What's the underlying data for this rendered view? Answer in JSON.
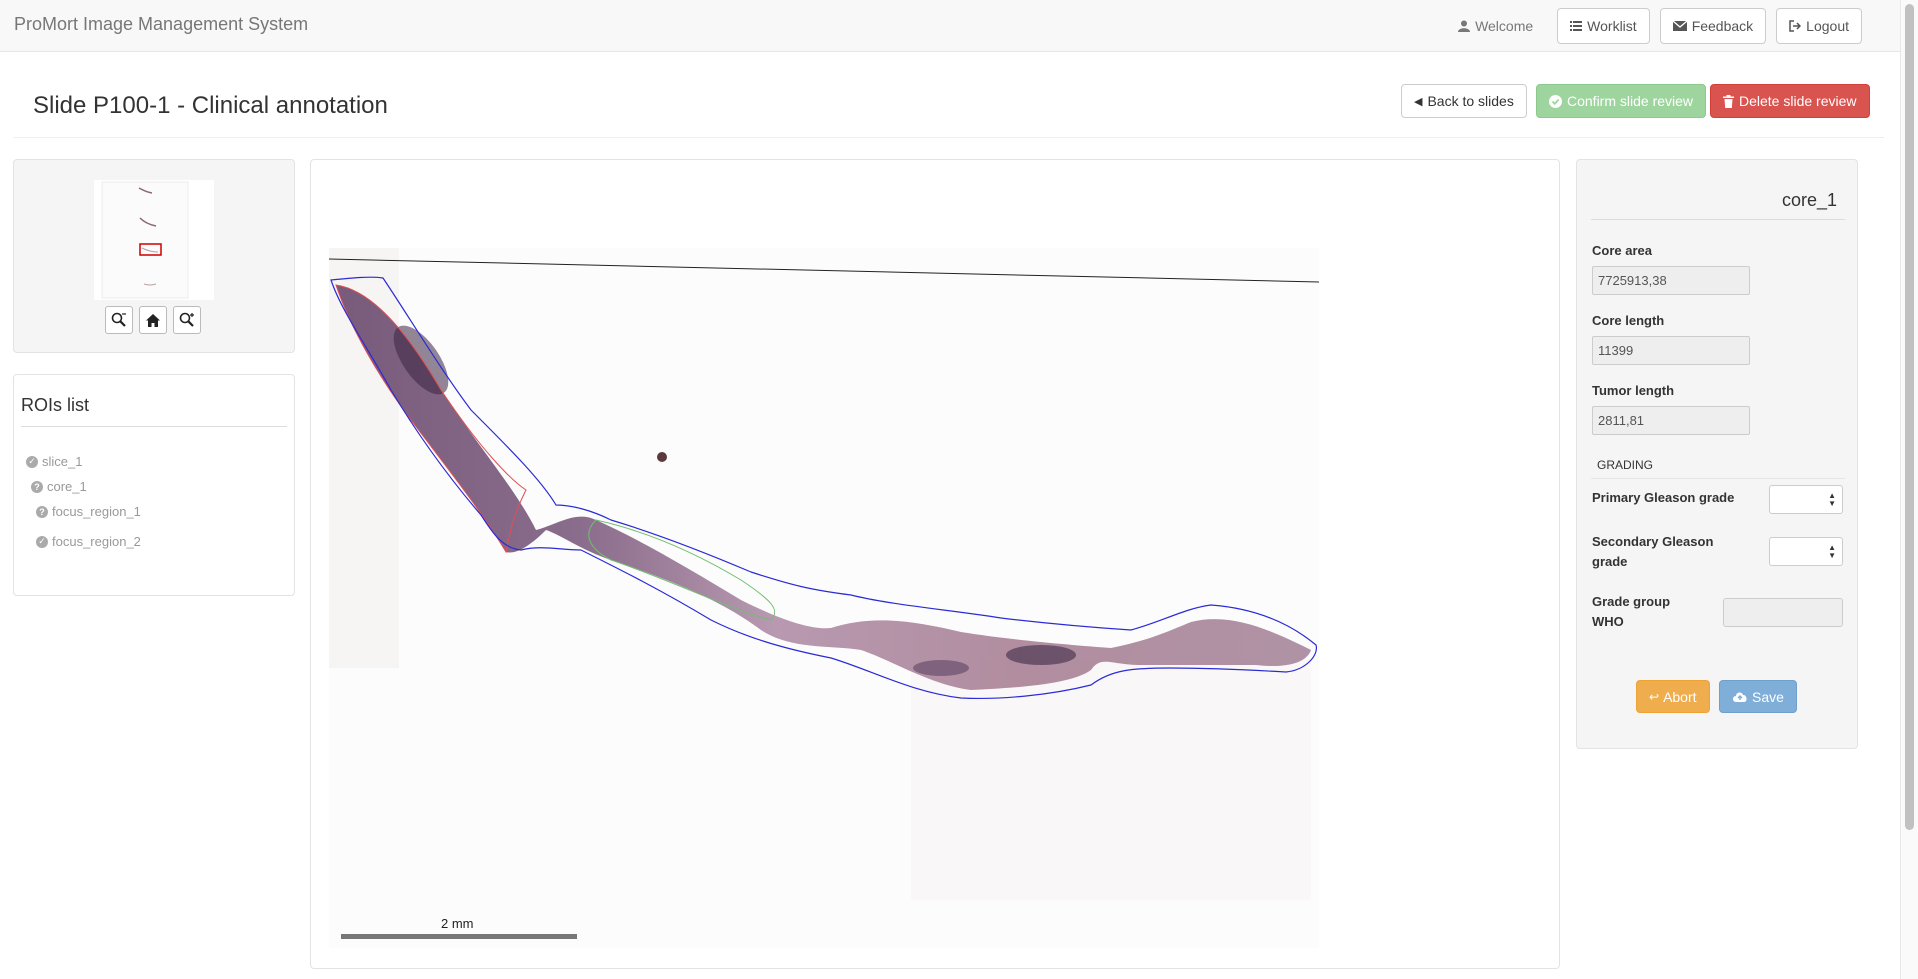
{
  "navbar": {
    "brand": "ProMort Image Management System",
    "welcome": "Welcome",
    "worklist": "Worklist",
    "feedback": "Feedback",
    "logout": "Logout"
  },
  "header": {
    "title": "Slide P100-1 - Clinical annotation",
    "back_label": "Back to slides",
    "confirm_label": "Confirm slide review",
    "delete_label": "Delete slide review"
  },
  "rois": {
    "title": "ROIs list",
    "items": [
      "slice_1",
      "core_1",
      "focus_region_1",
      "focus_region_2"
    ]
  },
  "viewer": {
    "scale_label": "2 mm"
  },
  "core": {
    "name": "core_1",
    "area_label": "Core area",
    "area_value": "7725913,38",
    "length_label": "Core length",
    "length_value": "11399",
    "tumor_label": "Tumor length",
    "tumor_value": "2811,81",
    "grading_label": "GRADING",
    "primary_label": "Primary Gleason grade",
    "secondary_label": "Secondary Gleason grade",
    "group_label": "Grade group WHO",
    "abort_label": "Abort",
    "save_label": "Save"
  },
  "colors": {
    "roi_outline": "#2b2bd6",
    "tumor_outline": "#e05050",
    "gland_outline": "#6fbf6f",
    "confirm": "#9ed59e",
    "delete": "#d9534f",
    "abort": "#f0ad4e",
    "save": "#7faed8"
  }
}
